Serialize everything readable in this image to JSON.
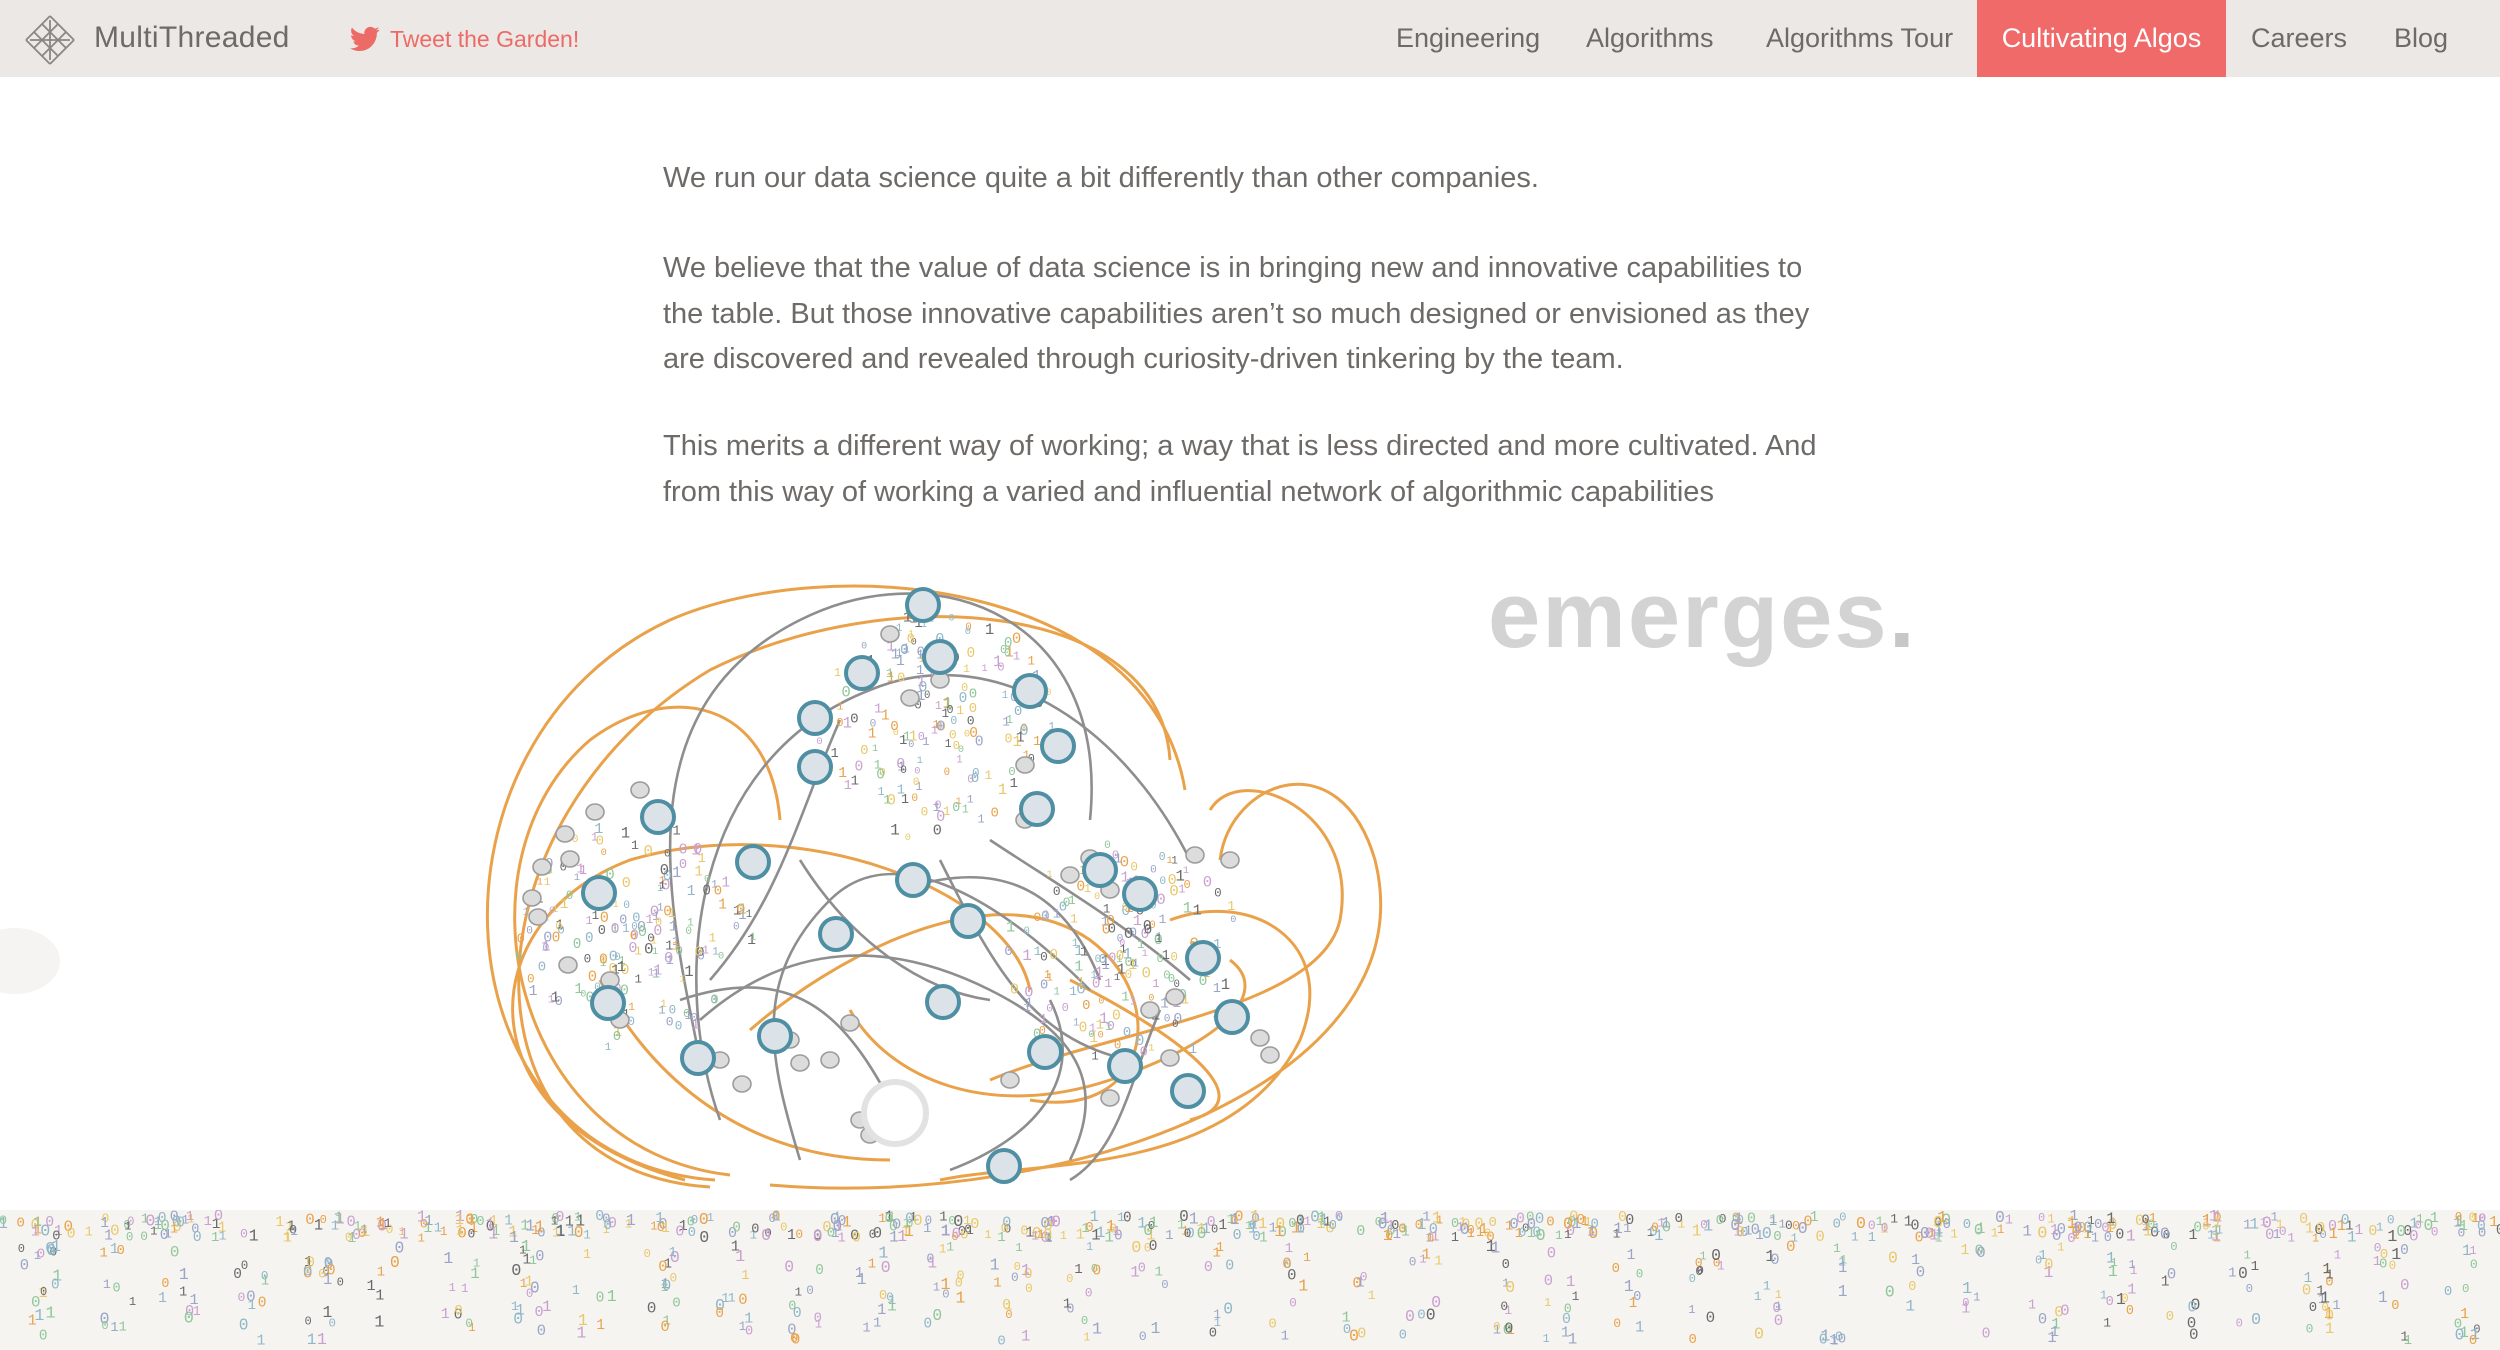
{
  "header": {
    "brand": "MultiThreaded",
    "tweet_label": "Tweet the Garden!",
    "nav": [
      {
        "label": "Engineering",
        "active": false
      },
      {
        "label": "Algorithms",
        "active": false
      },
      {
        "label": "Algorithms Tour",
        "active": false
      },
      {
        "label": "Cultivating Algos",
        "active": true
      },
      {
        "label": "Careers",
        "active": false
      },
      {
        "label": "Blog",
        "active": false
      }
    ]
  },
  "content": {
    "p1": "We run our data science quite a bit differently than other companies.",
    "p2": "We believe that the value of data science is in bringing new and innovative capabilities to the table. But those innovative capabilities aren’t so much designed or envisioned as they are discovered and revealed through curiosity-driven tinkering by the team.",
    "p3": "This merits a different way of working; a way that is less directed and more cultivated. And from this way of working a varied and influential network of algorithmic capabilities",
    "emerges": "emerges",
    "emerges_dot": "."
  },
  "colors": {
    "nav_bg": "#ece8e5",
    "accent": "#f06a6a",
    "text": "#6e6a67",
    "node_fill": "#dbe3e8",
    "node_stroke": "#4f8fa3",
    "orange_edge": "#e9a24a",
    "gray_edge": "#8e8e8e",
    "strip_bg": "#f6f4f1"
  },
  "icons": {
    "logo": "lattice-logo-icon",
    "tweet": "twitter-bird-icon"
  }
}
